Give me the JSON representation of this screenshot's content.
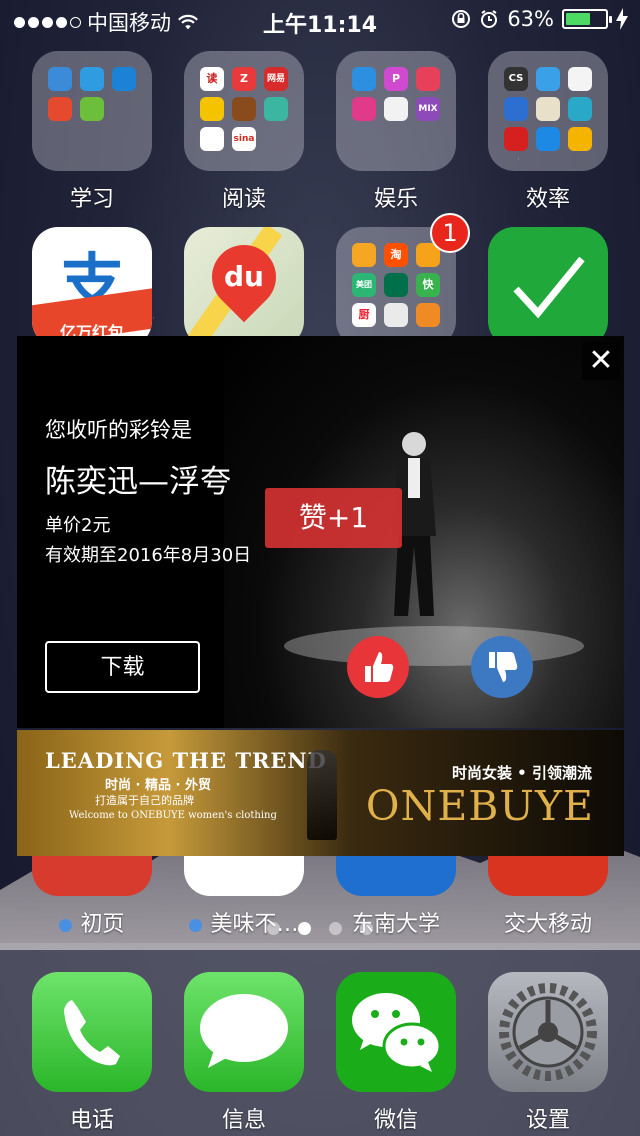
{
  "status_bar": {
    "carrier": "中国移动",
    "time": "上午11:14",
    "battery_percent": "63%",
    "battery_level": 0.63
  },
  "home": {
    "row1": [
      {
        "label": "学习"
      },
      {
        "label": "阅读"
      },
      {
        "label": "娱乐"
      },
      {
        "label": "效率"
      }
    ],
    "row2": {
      "alipay_banner_text": "亿万红包",
      "alipay_glyph": "支",
      "baidu_map_glyph": "du",
      "folder_badge": "1"
    },
    "row3": [
      {
        "label": "初页"
      },
      {
        "label": "美味不…"
      },
      {
        "label": "东南大学"
      },
      {
        "label": "交大移动"
      }
    ],
    "folder_reading_glyphs": [
      "读",
      "Z",
      "网易",
      "",
      "",
      "",
      "",
      "sina",
      ""
    ],
    "folder_ent_glyphs": [
      "",
      "P",
      "",
      "",
      "",
      "MIX"
    ],
    "folder_eff_glyphs": [
      "CS",
      "",
      "",
      "",
      "",
      "",
      "",
      "",
      ""
    ],
    "folder_shop_glyphs": [
      "",
      "淘",
      "",
      "美团",
      "",
      "快",
      "厨",
      "",
      ""
    ]
  },
  "popup": {
    "subtitle": "您收听的彩铃是",
    "song": "陈奕迅—浮夸",
    "price": "单价2元",
    "validity": "有效期至2016年8月30日",
    "like_tip": "赞+1",
    "download": "下载",
    "close": "✕"
  },
  "banner": {
    "headline": "LEADING THE TREND",
    "line1": "时尚 · 精品 · 外贸",
    "line2": "打造属于自己的品牌",
    "line3": "Welcome to ONEBUYE women's clothing",
    "tag": "时尚女装 • 引领潮流",
    "brand": "ONEBUYE"
  },
  "dock": [
    {
      "label": "电话"
    },
    {
      "label": "信息"
    },
    {
      "label": "微信"
    },
    {
      "label": "设置"
    }
  ],
  "colors": {
    "phone_green": "#4cd964",
    "wechat_green": "#1aad19",
    "like_red": "#e8353a",
    "dislike_blue": "#3d78c2",
    "badge_red": "#e8261c"
  }
}
